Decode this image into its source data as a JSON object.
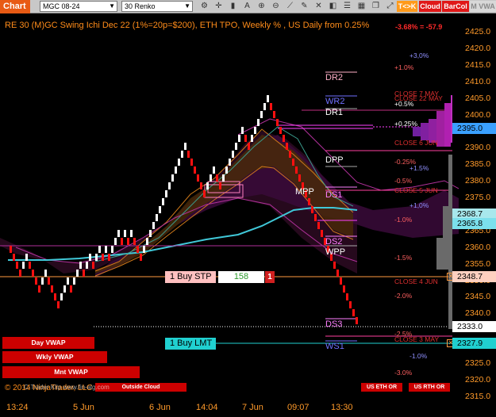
{
  "toolbar": {
    "chart_label": "Chart",
    "symbol": "MGC 08-24",
    "bar_type": "30 Renko",
    "tk_button": "T<>K",
    "cloud_button": "Cloud",
    "barcol_button": "BarCol",
    "mvwa_button": "M VWA",
    "icons": [
      "settings-icon",
      "crosshair-icon",
      "bar-icon",
      "text-icon",
      "zoom-in-icon",
      "zoom-out-icon",
      "drawing-icon",
      "pencil-icon",
      "cross-icon",
      "color-icon",
      "list-icon"
    ]
  },
  "chart": {
    "title": "RE 30 (M)GC Swing Ichi Dec 22 (1%=20p=$200), ETH TPO, Weekly % , US Daily from 0.25%",
    "pnl": "-3.68% = -57.9",
    "price_ticks": [
      "2425.0",
      "2420.0",
      "2415.0",
      "2410.0",
      "2405.0",
      "2400.0",
      "2395.0",
      "2390.0",
      "2385.0",
      "2380.0",
      "2375.0",
      "2370.0",
      "2365.0",
      "2360.0",
      "2355.0",
      "2350.0",
      "2345.0",
      "2340.0",
      "2335.0",
      "2330.0",
      "2325.0",
      "2320.0",
      "2315.0"
    ],
    "time_labels": [
      "13:24",
      "5 Jun",
      "6 Jun",
      "14:04",
      "7 Jun",
      "09:07",
      "13:30"
    ],
    "price_tags": [
      {
        "value": "2395.0",
        "color": "#3aa0ff"
      },
      {
        "value": "2368.7",
        "color": "#a8e8ec"
      },
      {
        "value": "2365.8",
        "color": "#7be0ec"
      },
      {
        "value": "2348.7",
        "color": "#ffd0c0"
      },
      {
        "value": "2333.0",
        "color": "#ffffff"
      },
      {
        "value": "2327.9",
        "color": "#20d0d0"
      }
    ],
    "levels": [
      {
        "text": "DR2",
        "color": "#ffb0c8"
      },
      {
        "text": "WR2",
        "color": "#7070ff"
      },
      {
        "text": "DR1",
        "color": "#ffffff"
      },
      {
        "text": "DPP",
        "color": "#ffffff"
      },
      {
        "text": "MPP",
        "color": "#ffffff"
      },
      {
        "text": "DS1",
        "color": "#ff80ff"
      },
      {
        "text": "DS2",
        "color": "#ff80ff"
      },
      {
        "text": "WPP",
        "color": "#ffffff"
      },
      {
        "text": "DS3",
        "color": "#ff80ff"
      },
      {
        "text": "WS1",
        "color": "#7070ff"
      }
    ],
    "percents": [
      {
        "text": "+3,0%",
        "color": "#9090ff"
      },
      {
        "text": "+1.0%",
        "color": "#ff6060"
      },
      {
        "text": "+0.5%",
        "color": "#ffffff"
      },
      {
        "text": "+0.25%",
        "color": "#ffffff"
      },
      {
        "text": "-0.25%",
        "color": "#ff6060"
      },
      {
        "text": "+1.5%",
        "color": "#9090ff"
      },
      {
        "text": "-0.5%",
        "color": "#ff6060"
      },
      {
        "text": "+1,0%",
        "color": "#9090ff"
      },
      {
        "text": "-1.0%",
        "color": "#ff6060"
      },
      {
        "text": "-1.5%",
        "color": "#ff6060"
      },
      {
        "text": "-2.0%",
        "color": "#ff6060"
      },
      {
        "text": "-2.5%",
        "color": "#ff6060"
      },
      {
        "text": "-1.0%",
        "color": "#9090ff"
      },
      {
        "text": "-3.0%",
        "color": "#ff6060"
      }
    ],
    "close_labels": [
      "CLOSE 7 MAY",
      "CLOSE 22 MAY",
      "CLOSE 6 JUN",
      "CLOSE 5 JUN",
      "CLOSE 4 JUN",
      "CLOSE 3 MAY"
    ],
    "orders": [
      {
        "label": "1 Buy STP",
        "qty": "158",
        "x": "1",
        "color": "#ffc0c0"
      },
      {
        "label": "1 Buy LMT",
        "color": "#20d0d0"
      }
    ],
    "vwap_labels": [
      "Day VWAP",
      "Wkly VWAP",
      "Mnt VWAP"
    ],
    "outside_cloud": "Outside Cloud",
    "copyright": "© 2014 NinjaTrader, LLC",
    "brand_overlay": "C-Trader Klip   www.fin-alg.com",
    "us_eth": "US ETH OR",
    "us_rth": "US RTH OR"
  }
}
